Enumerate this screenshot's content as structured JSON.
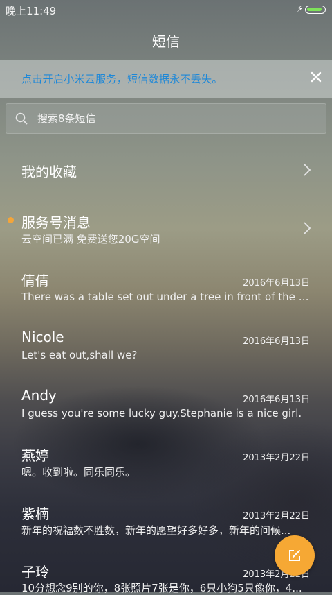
{
  "status_bar": {
    "time": "晚上11:49",
    "charge_symbol": "⚡",
    "battery_level": 0.92,
    "battery_color": "#7ee35a"
  },
  "header": {
    "title": "短信"
  },
  "banner": {
    "text": "点击开启小米云服务，短信数据永不丢失。",
    "text_color": "#1e88d8",
    "close_icon": "close-icon"
  },
  "search": {
    "placeholder": "搜索8条短信",
    "value": ""
  },
  "favorites": {
    "label": "我的收藏"
  },
  "service": {
    "title": "服务号消息",
    "preview": "云空间已满 免费送您20G空间",
    "unread_dot_color": "#f3a53a"
  },
  "conversations": [
    {
      "name": "倩倩",
      "date": "2016年6月13日",
      "preview": "There was a table set out under a tree in front of the ho..."
    },
    {
      "name": "Nicole",
      "date": "2016年6月13日",
      "preview": "Let's eat out,shall we?"
    },
    {
      "name": "Andy",
      "date": "2016年6月13日",
      "preview": "I guess you're some lucky guy.Stephanie is a nice girl."
    },
    {
      "name": "燕婷",
      "date": "2013年2月22日",
      "preview": "嗯。收到啦。同乐同乐。"
    },
    {
      "name": "紫楠",
      "date": "2013年2月22日",
      "preview": "新年的祝福数不胜数，新年的愿望好多好多，新年的问候..."
    },
    {
      "name": "子玲",
      "date": "2013年2月22日",
      "preview": "10分想念9别的你，8张照片7张是你，6只小狗5只像你，4..."
    }
  ],
  "fab": {
    "icon": "compose-icon",
    "color": "#f6a834"
  }
}
